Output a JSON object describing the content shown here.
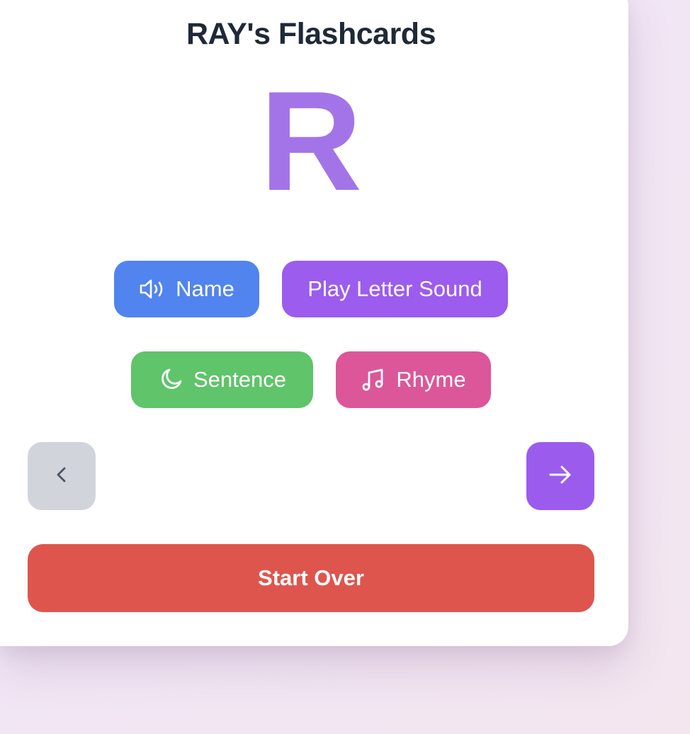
{
  "app": {
    "title": "RAY's Flashcards"
  },
  "card": {
    "letter": "R",
    "letter_color": "#a374e8"
  },
  "actions": {
    "name_label": "Name",
    "name_icon": "speaker-icon",
    "sound_label": "Play Letter Sound",
    "sentence_label": "Sentence",
    "sentence_icon": "moon-icon",
    "rhyme_label": "Rhyme",
    "rhyme_icon": "music-note-icon"
  },
  "navigation": {
    "prev_icon": "chevron-left-icon",
    "next_icon": "arrow-right-icon"
  },
  "footer": {
    "start_over_label": "Start Over"
  },
  "colors": {
    "name_button": "#5184ee",
    "sound_button": "#9c5ced",
    "sentence_button": "#5fc46a",
    "rhyme_button": "#db5799",
    "prev_button": "#d1d5db",
    "next_button": "#9b5ced",
    "start_over_button": "#de554d",
    "title_text": "#1f2937"
  }
}
